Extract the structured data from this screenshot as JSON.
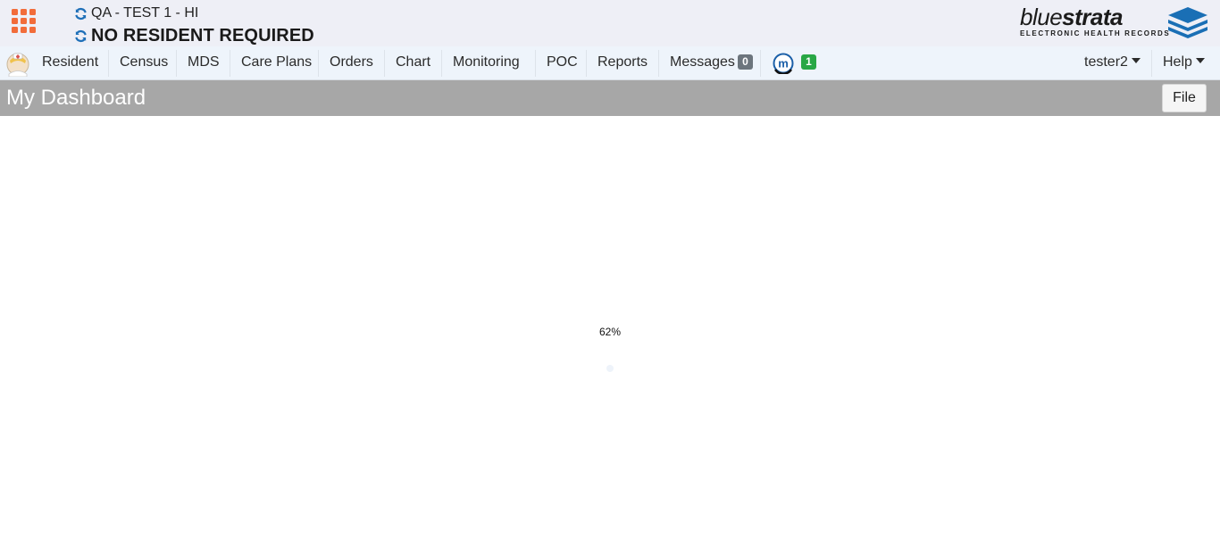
{
  "header": {
    "facility": "QA - TEST 1 - HI",
    "resident": "NO RESIDENT REQUIRED",
    "brand": {
      "name_light": "blue",
      "name_bold": "strata",
      "tagline": "ELECTRONIC HEALTH RECORDS"
    }
  },
  "nav": {
    "items": [
      "Resident",
      "Census",
      "MDS",
      "Care Plans",
      "Orders",
      "Chart",
      "Monitoring",
      "POC",
      "Reports"
    ],
    "messages_label": "Messages",
    "messages_count": "0",
    "monitor_count": "1",
    "user": "tester2",
    "help": "Help"
  },
  "page": {
    "title": "My Dashboard",
    "file_button": "File"
  },
  "loading": {
    "progress_text": "62%",
    "progress": 0.62
  },
  "colors": {
    "apps_orange": "#f26c3a",
    "brand_blue": "#1a6fb5",
    "title_bar": "#a7a7a7",
    "nav_bg": "#eef4fb"
  },
  "icons": [
    "apps-grid-icon",
    "refresh-icon",
    "nurse-avatar-icon",
    "monitor-m-icon",
    "caret-down-icon",
    "bluestrata-logo-icon"
  ]
}
